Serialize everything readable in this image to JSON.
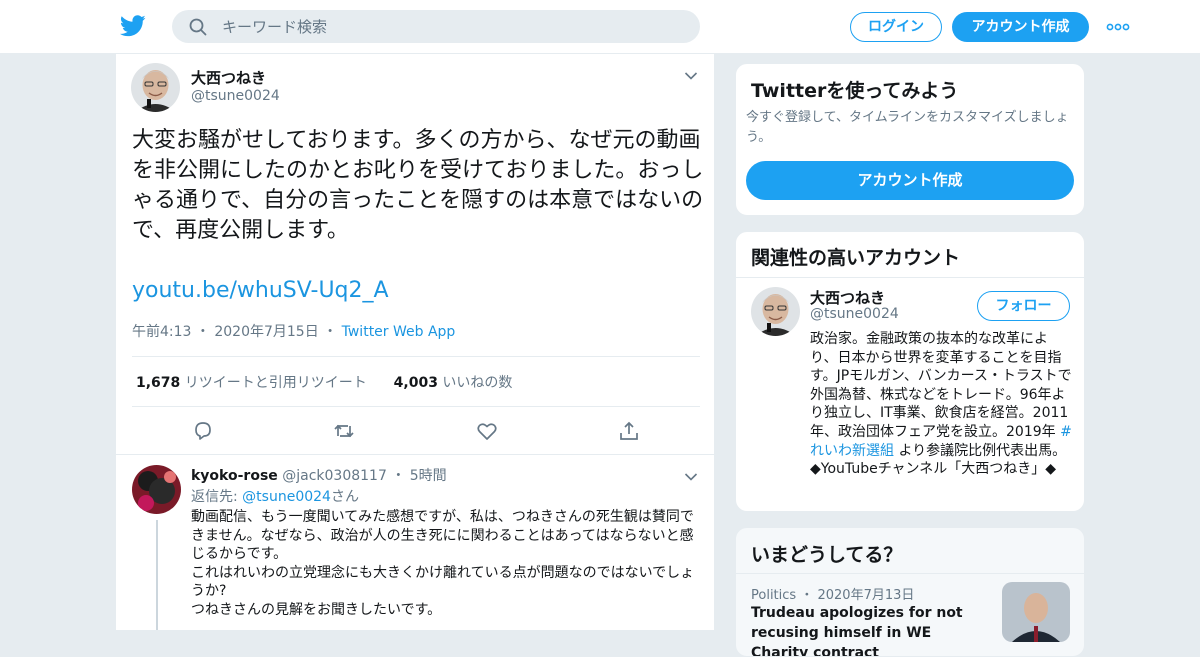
{
  "topbar": {
    "search_placeholder": "キーワード検索",
    "login_label": "ログイン",
    "signup_label": "アカウント作成"
  },
  "colors": {
    "brand": "#1da1f2",
    "link": "#1b95e0",
    "muted": "#657786",
    "background": "#e6ecf0"
  },
  "tweet": {
    "author_name": "大西つねき",
    "author_handle": "@tsune0024",
    "text": "大変お騒がせしております。多くの方から、なぜ元の動画を非公開にしたのかとお叱りを受けておりました。おっしゃる通りで、自分の言ったことを隠すのは本意ではないので、再度公開します。",
    "link": "youtu.be/whuSV-Uq2_A",
    "time": "午前4:13",
    "date": "2020年7月15日",
    "source": "Twitter Web App",
    "retweet_count": "1,678",
    "retweet_label": "リツイートと引用リツイート",
    "like_count": "4,003",
    "like_label": "いいねの数"
  },
  "reply": {
    "author_name": "kyoko-rose",
    "author_handle": "@jack0308117",
    "time": "5時間",
    "reply_to_prefix": "返信先: ",
    "reply_to_handle": "@tsune0024",
    "reply_to_suffix": "さん",
    "lines": [
      "動画配信、もう一度聞いてみた感想ですが、私は、つねきさんの死生観は賛同できません。なぜなら、政治が人の生き死にに関わることはあってはならないと感じるからです。",
      "これはれいわの立党理念にも大きくかけ離れている点が問題なのではないでしょうか?",
      "つねきさんの見解をお聞きしたいです。"
    ]
  },
  "sidebar": {
    "try_card": {
      "title": "Twitterを使ってみよう",
      "subtitle": "今すぐ登録して、タイムラインをカスタマイズしましょう。",
      "button": "アカウント作成"
    },
    "related": {
      "title": "関連性の高いアカウント",
      "name": "大西つねき",
      "handle": "@tsune0024",
      "follow_label": "フォロー",
      "bio_before": "政治家。金融政策の抜本的な改革により、日本から世界を変革することを目指す。JPモルガン、バンカース・トラストで外国為替、株式などをトレード。96年より独立し、IT事業、飲食店を経営。2011年、政治団体フェア党を設立。2019年 ",
      "bio_tag": "#れいわ新選組",
      "bio_after": " より参議院比例代表出馬。◆YouTubeチャンネル「大西つねき」◆"
    },
    "trends": {
      "title": "いまどうしてる？",
      "category": "Politics",
      "date": "2020年7月13日",
      "headline": "Trudeau apologizes for not recusing himself in WE Charity contract"
    }
  }
}
